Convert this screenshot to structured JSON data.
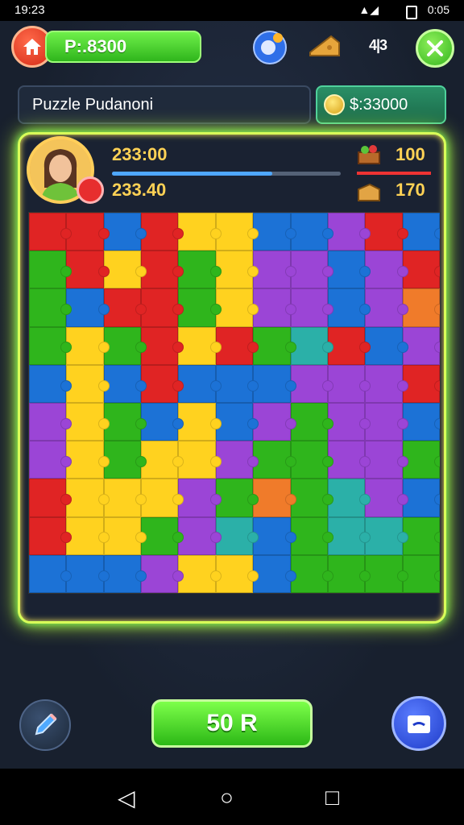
{
  "status": {
    "time": "19:23",
    "right": "0:05"
  },
  "header": {
    "coins": "P:.8300",
    "timer": "4|3"
  },
  "player": {
    "name": "Puzzle Pudanoni",
    "balance": "$:33000"
  },
  "stats": {
    "score_a": "233:00",
    "score_b": "233.40",
    "count_a": "100",
    "count_b": "170",
    "progress": 0.7
  },
  "actions": {
    "play_label": "50 R"
  },
  "icons": {
    "home": "home-icon",
    "globe": "globe-icon",
    "cheese": "cheese-icon",
    "close": "close-icon",
    "pencil": "pencil-icon",
    "camera": "camera-icon",
    "basket": "basket-icon",
    "box": "box-icon"
  },
  "colors": {
    "accent_green": "#2fb51c",
    "red": "#e02424",
    "yellow": "#ffd21f",
    "blue": "#1c72d6",
    "purple": "#9b45d6",
    "orange": "#f07b2a",
    "teal": "#2bb0a8"
  },
  "board_rows": [
    [
      "r",
      "r",
      "b",
      "r",
      "y",
      "y",
      "b",
      "b",
      "p",
      "r",
      "b"
    ],
    [
      "g",
      "r",
      "y",
      "r",
      "g",
      "y",
      "p",
      "p",
      "b",
      "p",
      "r"
    ],
    [
      "g",
      "b",
      "r",
      "r",
      "g",
      "y",
      "p",
      "p",
      "b",
      "p",
      "o"
    ],
    [
      "g",
      "y",
      "g",
      "r",
      "y",
      "r",
      "g",
      "t",
      "r",
      "b",
      "p"
    ],
    [
      "b",
      "y",
      "b",
      "r",
      "b",
      "b",
      "b",
      "p",
      "p",
      "p",
      "r"
    ],
    [
      "p",
      "y",
      "g",
      "b",
      "y",
      "b",
      "p",
      "g",
      "p",
      "p",
      "b"
    ],
    [
      "p",
      "y",
      "g",
      "y",
      "y",
      "p",
      "g",
      "g",
      "p",
      "p",
      "g"
    ],
    [
      "r",
      "y",
      "y",
      "y",
      "p",
      "g",
      "o",
      "g",
      "t",
      "p",
      "b"
    ],
    [
      "r",
      "y",
      "y",
      "g",
      "p",
      "t",
      "b",
      "g",
      "t",
      "t",
      "g"
    ],
    [
      "b",
      "b",
      "b",
      "p",
      "y",
      "y",
      "b",
      "g",
      "g",
      "g",
      "g"
    ]
  ]
}
